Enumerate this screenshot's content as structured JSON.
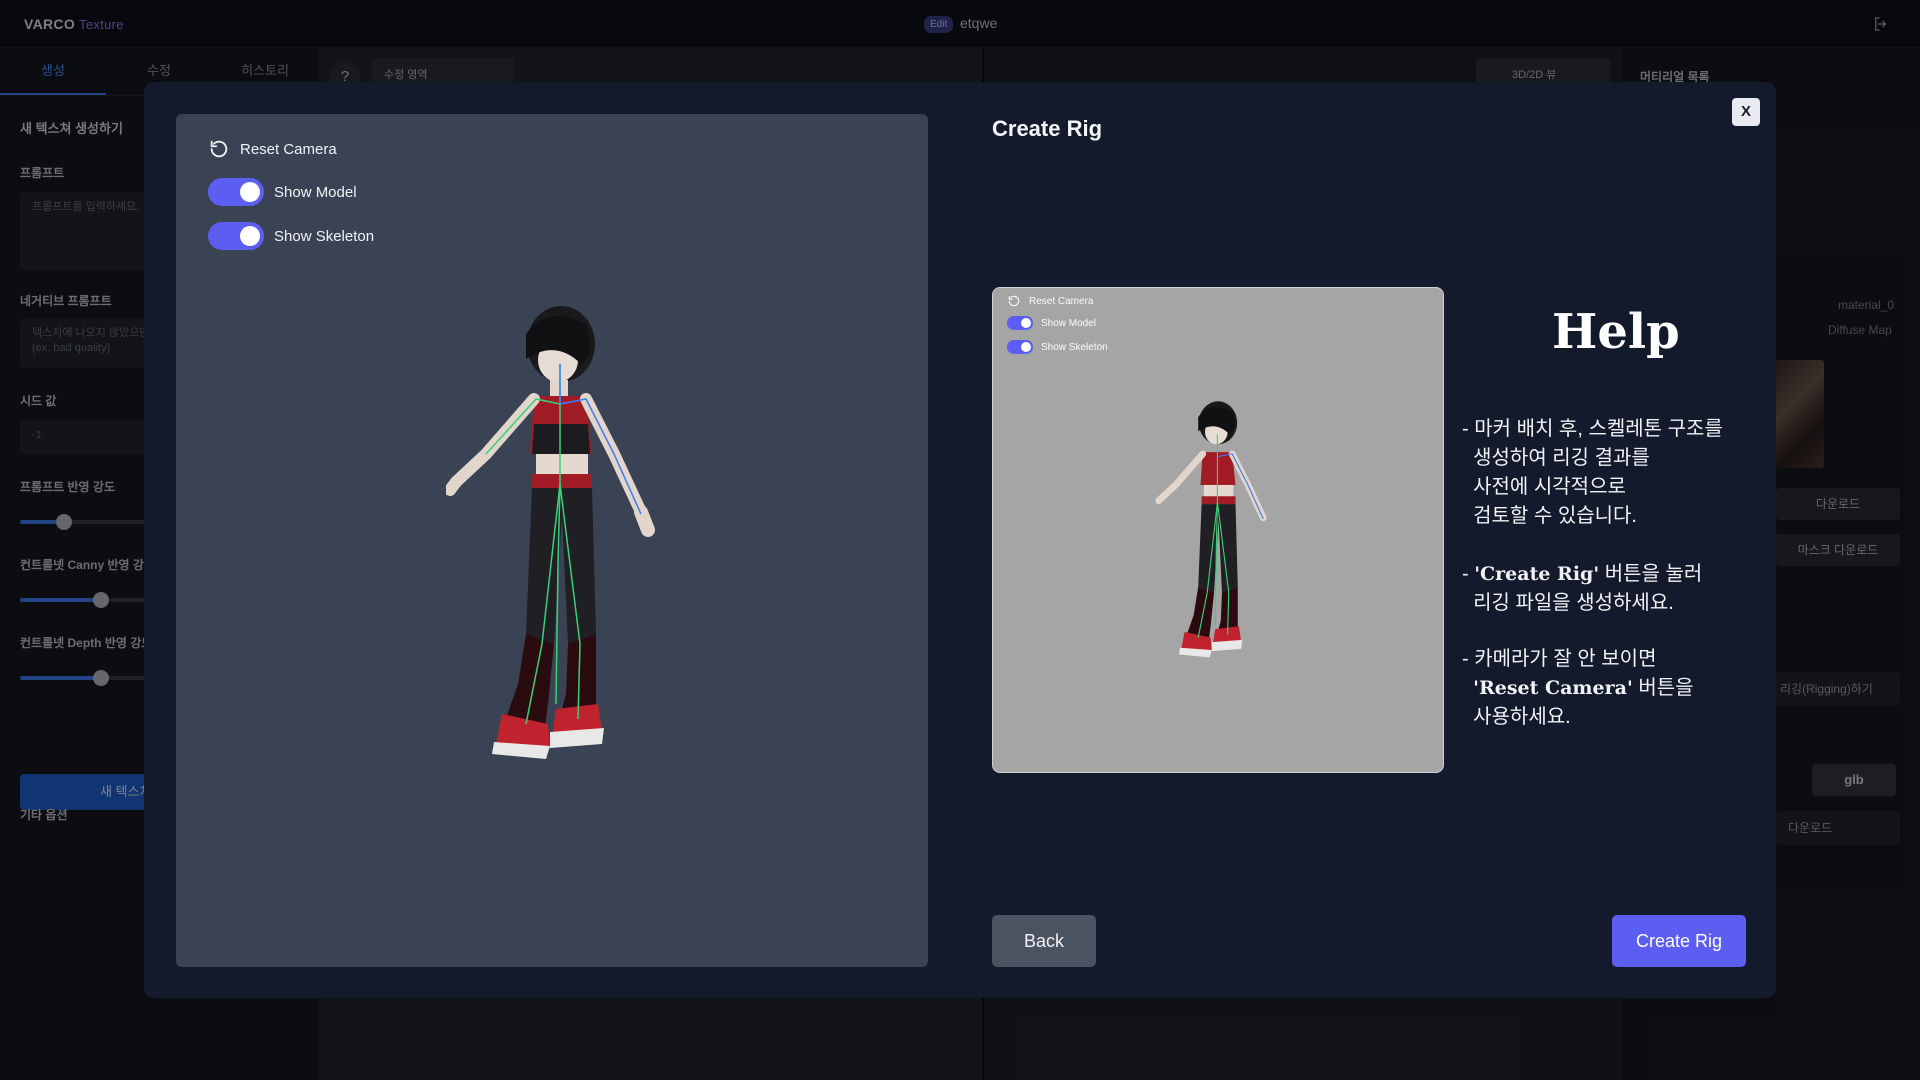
{
  "app": {
    "brand": "VARCO",
    "brand_sub": "Texture",
    "edit_badge": "Edit",
    "project_name": "etqwe"
  },
  "left_panel": {
    "tabs": [
      {
        "label": "생성"
      },
      {
        "label": "수정"
      },
      {
        "label": "히스토리"
      }
    ],
    "title": "새 텍스쳐 생성하기",
    "prompt_label": "프롬프트",
    "prompt_placeholder": "프롬프트를 입력하세요.",
    "negative_label": "네거티브 프롬프트",
    "negative_placeholder": "텍스처에 나오지 않았으면 하는 요소를 입력하세요.\n(ex. bad quality)",
    "seed_label": "시드 값",
    "seed_value": "-1",
    "strength_label": "프롬프트 반영 강도",
    "strength_value": 0.15,
    "canny_label": "컨트롤넷 Canny 반영 강도",
    "canny_value": 0.28,
    "depth_label": "컨트롤넷 Depth 반영 강도",
    "depth_value": 0.28,
    "generate_label": "새 텍스쳐 생성하기",
    "other_options": "기타 옵션"
  },
  "viewport": {
    "help": "?",
    "edit_area_label": "수정 영역",
    "view_toggle_label": "3D/2D 뷰"
  },
  "right_panel": {
    "title": "머티리얼 목록",
    "material_name": "material_0",
    "map_name": "Diffuse Map",
    "download_label": "다운로드",
    "mask_download_label": "마스크 다운로드",
    "rigging_label": "리깅(Rigging)하기",
    "format_selected": "glb",
    "file_download_label": "다운로드"
  },
  "modal": {
    "title": "Create Rig",
    "close_label": "X",
    "reset_camera": "Reset Camera",
    "show_model": "Show Model",
    "show_skeleton": "Show Skeleton",
    "show_model_on": true,
    "show_skeleton_on": true,
    "preview": {
      "reset_camera": "Reset Camera",
      "show_model": "Show Model",
      "show_skeleton": "Show Skeleton"
    },
    "help_title": "Help",
    "help_1": "- 마커 배치 후, 스켈레톤 구조를\n  생성하여 리깅 결과를\n  사전에 시각적으로\n  검토할 수 있습니다.",
    "help_2_bold": "'Create Rig'",
    "help_2_rest": " 버튼을 눌러\n  리깅 파일을 생성하세요.",
    "help_3_a": "- 카메라가 잘 안 보이면",
    "help_3_bold": "'Reset Camera'",
    "help_3_rest": " 버튼을\n  사용하세요.",
    "back_label": "Back",
    "create_label": "Create Rig"
  },
  "colors": {
    "accent": "#5b5ef0",
    "modal_bg": "#131a2c",
    "viewer_bg": "#3a4354",
    "preview_bg": "#a5a5a5"
  }
}
